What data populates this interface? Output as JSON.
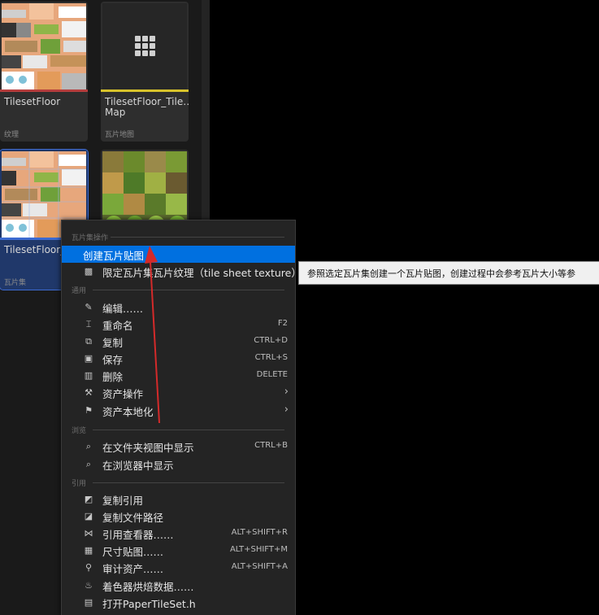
{
  "assets": [
    {
      "name": "TilesetFloor",
      "type": "纹理",
      "bar_color": "#b53d3d"
    },
    {
      "name": "TilesetFloor_TileMap",
      "name_line1": "TilesetFloor_Tile…",
      "name_line2": "Map",
      "type": "瓦片地图",
      "bar_color": "#d8c32b"
    },
    {
      "name": "TilesetFloor_TileSet",
      "name_shown": "TilesetFloor_T",
      "type": "瓦片集",
      "bar_color": "#3c6ad0"
    },
    {
      "name": "",
      "type": "",
      "bar_color": "#3a3a3a"
    }
  ],
  "menu": {
    "section_tileset": "瓦片集操作",
    "create_tile_map": "创建瓦片贴图",
    "limit_texture": "限定瓦片集瓦片纹理（tile sheet texture）",
    "section_common": "通用",
    "items_common": [
      {
        "label": "编辑……",
        "shortcut": "",
        "icon": "pencil-icon"
      },
      {
        "label": "重命名",
        "shortcut": "F2",
        "icon": "rename-icon"
      },
      {
        "label": "复制",
        "shortcut": "CTRL+D",
        "icon": "duplicate-icon"
      },
      {
        "label": "保存",
        "shortcut": "CTRL+S",
        "icon": "save-icon"
      },
      {
        "label": "删除",
        "shortcut": "DELETE",
        "icon": "trash-icon"
      },
      {
        "label": "资产操作",
        "shortcut": "",
        "icon": "wrench-icon",
        "submenu": true
      },
      {
        "label": "资产本地化",
        "shortcut": "",
        "icon": "flag-icon",
        "submenu": true
      }
    ],
    "section_browse": "浏览",
    "items_browse": [
      {
        "label": "在文件夹视图中显示",
        "shortcut": "CTRL+B",
        "icon": "folder-search-icon"
      },
      {
        "label": "在浏览器中显示",
        "shortcut": "",
        "icon": "folder-search-icon"
      }
    ],
    "section_reference": "引用",
    "items_reference": [
      {
        "label": "复制引用",
        "shortcut": "",
        "icon": "copy-reference-icon"
      },
      {
        "label": "复制文件路径",
        "shortcut": "",
        "icon": "copy-path-icon"
      },
      {
        "label": "引用查看器……",
        "shortcut": "ALT+SHIFT+R",
        "icon": "reference-viewer-icon"
      },
      {
        "label": "尺寸贴图……",
        "shortcut": "ALT+SHIFT+M",
        "icon": "size-map-icon"
      },
      {
        "label": "审计资产……",
        "shortcut": "ALT+SHIFT+A",
        "icon": "audit-icon"
      },
      {
        "label": "着色器烘焙数据……",
        "shortcut": "",
        "icon": "shader-icon"
      },
      {
        "label": "打开PaperTileSet.h",
        "shortcut": "",
        "icon": "code-file-icon"
      }
    ]
  },
  "tooltip": "参照选定瓦片集创建一个瓦片贴图，创建过程中会参考瓦片大小等参",
  "colors": {
    "highlight": "#0070e0",
    "annotation_arrow": "#d42a2a",
    "panel": "#1a1a1a"
  }
}
